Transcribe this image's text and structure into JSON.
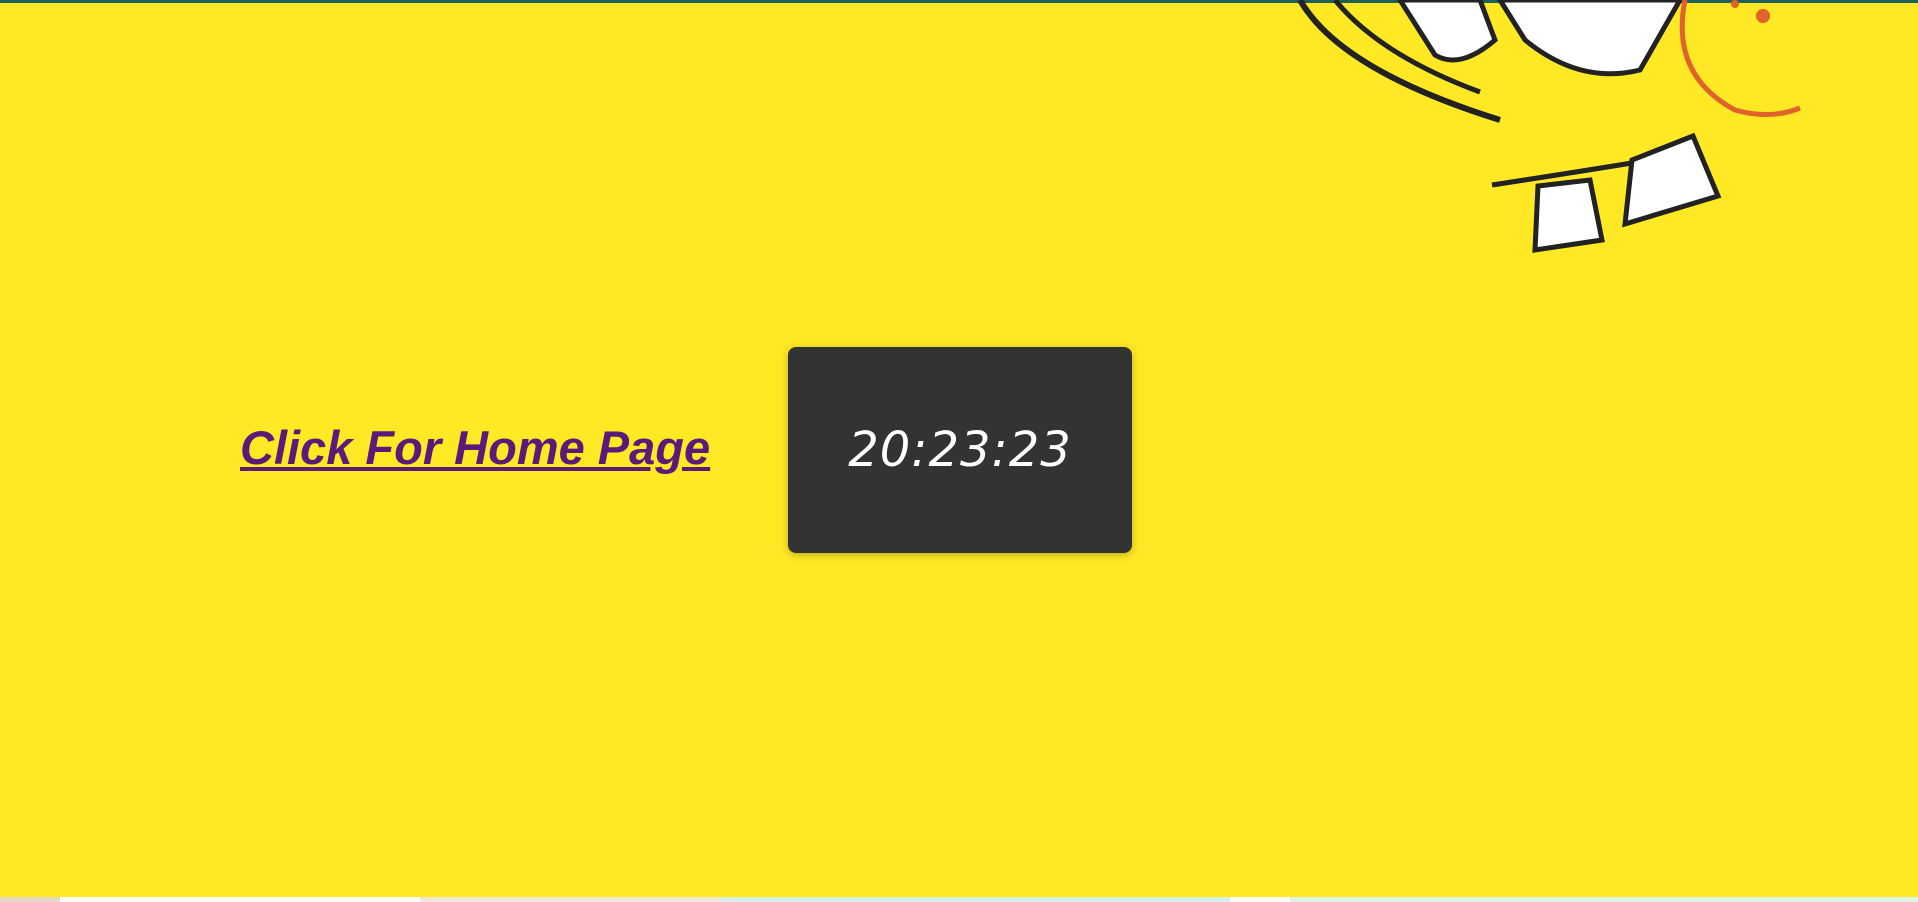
{
  "page": {
    "link_label": "Click For Home Page",
    "clock_time": "20:23:23"
  },
  "colors": {
    "background": "#ffe824",
    "top_bar": "#1e5f5a",
    "link": "#5a1a7a",
    "clock_box": "#333333",
    "clock_text": "#ffffff"
  },
  "icons": {
    "background_art": "cartoon-face-illustration"
  }
}
